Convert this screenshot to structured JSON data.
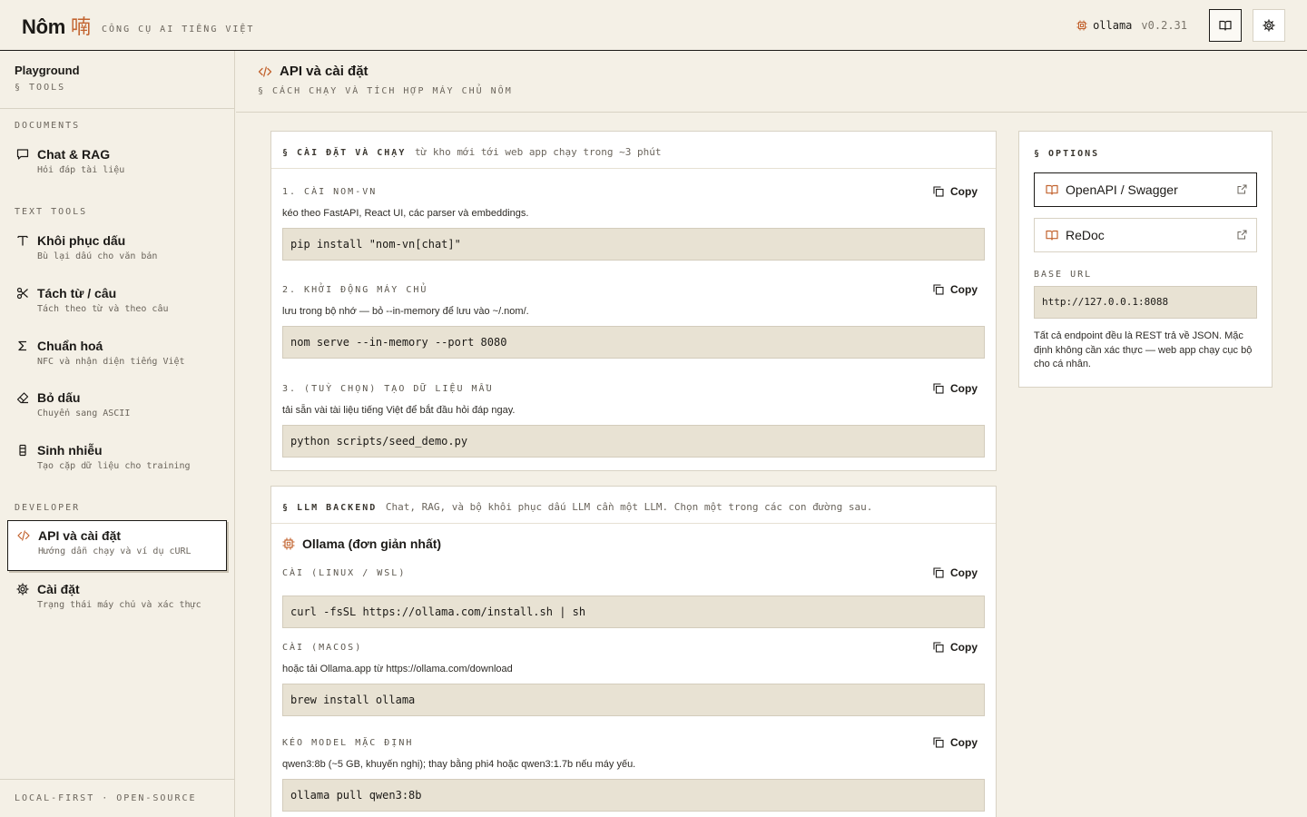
{
  "header": {
    "brand": "Nôm",
    "brand_glyph": "喃",
    "tagline": "CÔNG CỤ AI TIẾNG VIỆT",
    "model": "ollama",
    "version": "v0.2.31",
    "docs_icon": "book-icon",
    "settings_icon": "gear-icon"
  },
  "sidebar": {
    "title": "Playground",
    "subtitle": "§ TOOLS",
    "sections": {
      "documents": "DOCUMENTS",
      "text_tools": "TEXT TOOLS",
      "developer": "DEVELOPER"
    },
    "items": [
      {
        "label": "Chat & RAG",
        "desc": "Hỏi đáp tài liệu",
        "icon": "chat-bubble-icon"
      },
      {
        "label": "Khôi phục dấu",
        "desc": "Bù lại dấu cho văn bản",
        "icon": "text-t-icon"
      },
      {
        "label": "Tách từ / câu",
        "desc": "Tách theo từ và theo câu",
        "icon": "scissors-icon"
      },
      {
        "label": "Chuẩn hoá",
        "desc": "NFC và nhận diện tiếng Việt",
        "icon": "sigma-icon"
      },
      {
        "label": "Bỏ dấu",
        "desc": "Chuyển sang ASCII",
        "icon": "eraser-icon"
      },
      {
        "label": "Sinh nhiễu",
        "desc": "Tạo cặp dữ liệu cho training",
        "icon": "noise-icon"
      },
      {
        "label": "API và cài đặt",
        "desc": "Hướng dẫn chạy và ví dụ cURL",
        "icon": "code-icon"
      },
      {
        "label": "Cài đặt",
        "desc": "Trạng thái máy chủ và xác thực",
        "icon": "gear-icon"
      }
    ],
    "active_item": "API và cài đặt",
    "footer": "LOCAL-FIRST · OPEN-SOURCE"
  },
  "page": {
    "title": "API và cài đặt",
    "subtitle": "§ CÁCH CHẠY VÀ TÍCH HỢP MÁY CHỦ NÔM"
  },
  "install": {
    "heading": "§ CÀI ĐẶT VÀ CHẠY",
    "heading_desc": "từ kho mới tới web app chạy trong ~3 phút",
    "steps": [
      {
        "title": "1. CÀI NOM-VN",
        "desc": "kéo theo FastAPI, React UI, các parser và embeddings.",
        "code": "pip install \"nom-vn[chat]\""
      },
      {
        "title": "2. KHỞI ĐỘNG MÁY CHỦ",
        "desc": "lưu trong bộ nhớ — bỏ --in-memory để lưu vào ~/.nom/.",
        "code": "nom serve --in-memory --port 8080"
      },
      {
        "title": "3. (TUỲ CHỌN) TẠO DỮ LIỆU MẪU",
        "desc": "tải sẵn vài tài liệu tiếng Việt để bắt đầu hỏi đáp ngay.",
        "code": "python scripts/seed_demo.py"
      }
    ]
  },
  "backend": {
    "heading": "§ LLM BACKEND",
    "heading_desc": "Chat, RAG, và bộ khôi phục dấu LLM cần một LLM. Chọn một trong các con đường sau.",
    "provider": "Ollama (đơn giản nhất)",
    "steps": [
      {
        "title": "CÀI (LINUX / WSL)",
        "desc": "",
        "code": "curl -fsSL https://ollama.com/install.sh | sh"
      },
      {
        "title": "CÀI (MACOS)",
        "desc": "hoặc tải Ollama.app từ https://ollama.com/download",
        "code": "brew install ollama"
      },
      {
        "title": "KÉO MODEL MẶC ĐỊNH",
        "desc": "qwen3:8b (~5 GB, khuyến nghị); thay bằng phi4 hoặc qwen3:1.7b nếu máy yếu.",
        "code": "ollama pull qwen3:8b"
      }
    ]
  },
  "copy_label": "Copy",
  "options": {
    "heading": "§ OPTIONS",
    "links": [
      {
        "label": "OpenAPI / Swagger",
        "icon": "book-icon"
      },
      {
        "label": "ReDoc",
        "icon": "book-icon"
      }
    ],
    "base_url_label": "BASE URL",
    "base_url": "http://127.0.0.1:8088",
    "note": "Tất cả endpoint đều là REST trả về JSON. Mặc định không cần xác thực — web app chạy cục bộ cho cá nhân."
  },
  "colors": {
    "accent": "#c2632f",
    "background": "#f4f0e6",
    "code_bg": "#e8e2d3",
    "ink": "#1c1a17"
  }
}
